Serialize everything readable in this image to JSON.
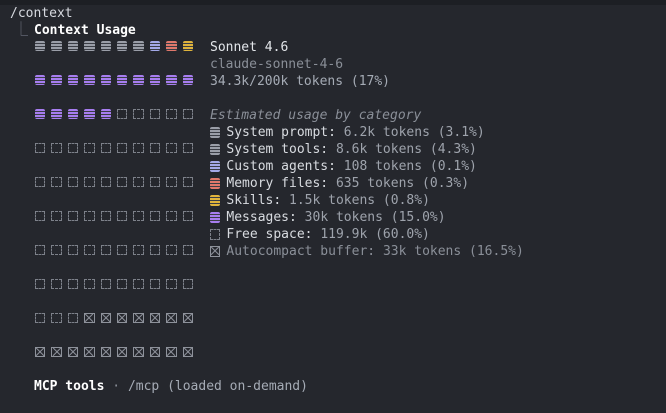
{
  "command": "/context",
  "tree_glyph": "⎿",
  "title": "Context Usage",
  "model": {
    "name": "Sonnet 4.6",
    "id": "claude-sonnet-4-6",
    "tokens": "34.3k/200k tokens (17%)"
  },
  "estimated_header": "Estimated usage by category",
  "categories": [
    {
      "label": "System prompt:",
      "value": "6.2k tokens (3.1%)",
      "icon": "system-prompt-icon"
    },
    {
      "label": "System tools:",
      "value": "8.6k tokens (4.3%)",
      "icon": "system-tools-icon"
    },
    {
      "label": "Custom agents:",
      "value": "108 tokens (0.1%)",
      "icon": "custom-agents-icon"
    },
    {
      "label": "Memory files:",
      "value": "635 tokens (0.3%)",
      "icon": "memory-files-icon"
    },
    {
      "label": "Skills:",
      "value": "1.5k tokens (0.8%)",
      "icon": "skills-icon"
    },
    {
      "label": "Messages:",
      "value": "30k tokens (15.0%)",
      "icon": "messages-icon"
    },
    {
      "label": "Free space:",
      "value": "119.9k (60.0%)",
      "icon": "free-space-icon"
    },
    {
      "label": "Autocompact buffer:",
      "value": "33k tokens (16.5%)",
      "icon": "autocompact-buffer-icon"
    }
  ],
  "colors": {
    "system": "#9a9ea8",
    "custom_agents": "#a3a9e8",
    "memory_files": "#e0786b",
    "skills": "#e0b43c",
    "messages": "#a77df0",
    "free": "#7d818a",
    "buffer": "#8e929b"
  },
  "grid_rows": [
    [
      "sys",
      "sys",
      "sys",
      "tools",
      "tools",
      "tools",
      "tools",
      "agent",
      "mem",
      "skill"
    ],
    [
      "msg",
      "msg",
      "msg",
      "msg",
      "msg",
      "msg",
      "msg",
      "msg",
      "msg",
      "msg"
    ],
    [
      "msg",
      "msg",
      "msg",
      "msg",
      "msg",
      "free",
      "free",
      "free",
      "free",
      "free"
    ],
    [
      "free",
      "free",
      "free",
      "free",
      "free",
      "free",
      "free",
      "free",
      "free",
      "free"
    ],
    [
      "free",
      "free",
      "free",
      "free",
      "free",
      "free",
      "free",
      "free",
      "free",
      "free"
    ],
    [
      "free",
      "free",
      "free",
      "free",
      "free",
      "free",
      "free",
      "free",
      "free",
      "free"
    ],
    [
      "free",
      "free",
      "free",
      "free",
      "free",
      "free",
      "free",
      "free",
      "free",
      "free"
    ],
    [
      "free",
      "free",
      "free",
      "free",
      "free",
      "free",
      "free",
      "free",
      "free",
      "free"
    ],
    [
      "free",
      "free",
      "free",
      "buf",
      "buf",
      "buf",
      "buf",
      "buf",
      "buf",
      "buf"
    ],
    [
      "buf",
      "buf",
      "buf",
      "buf",
      "buf",
      "buf",
      "buf",
      "buf",
      "buf",
      "buf"
    ]
  ],
  "mcp": {
    "label": "MCP tools",
    "separator": " · ",
    "rest": "/mcp (loaded on-demand)"
  }
}
